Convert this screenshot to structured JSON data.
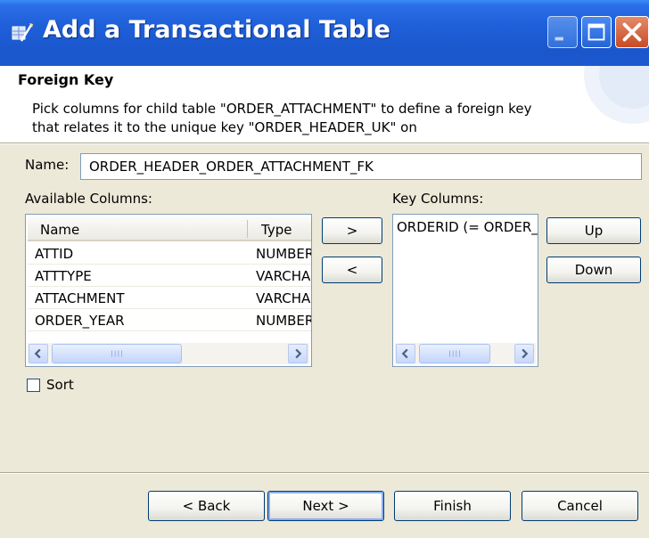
{
  "window": {
    "title": "Add a Transactional Table",
    "title_icon": "wizard-icon",
    "controls": [
      "minimize-icon",
      "maximize-icon",
      "close-icon"
    ]
  },
  "header": {
    "title": "Foreign Key",
    "description": "Pick columns for child table \"ORDER_ATTACHMENT\" to define a foreign key that relates it to the unique key \"ORDER_HEADER_UK\" on"
  },
  "form": {
    "name_label": "Name:",
    "name_value": "ORDER_HEADER_ORDER_ATTACHMENT_FK",
    "available_label": "Available Columns:",
    "key_label": "Key Columns:"
  },
  "available_columns": {
    "headers": [
      "Name",
      "Type"
    ],
    "rows": [
      {
        "name": "ATTID",
        "type": "NUMBER"
      },
      {
        "name": "ATTTYPE",
        "type": "VARCHAR"
      },
      {
        "name": "ATTACHMENT",
        "type": "VARCHAR"
      },
      {
        "name": "ORDER_YEAR",
        "type": "NUMBER"
      }
    ]
  },
  "key_columns": [
    "ORDERID (= ORDER_HEADER.ORDERID)"
  ],
  "buttons": {
    "add": ">",
    "remove": "<",
    "up": "Up",
    "down": "Down",
    "back": "< Back",
    "next": "Next >",
    "finish": "Finish",
    "cancel": "Cancel"
  },
  "sort": {
    "label": "Sort",
    "checked": false
  },
  "colors": {
    "titlebar": "#1f5fd8",
    "dialog_bg": "#ece9d8",
    "button_border": "#003c74"
  }
}
